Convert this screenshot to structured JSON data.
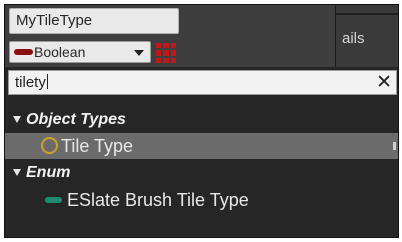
{
  "variable": {
    "name_value": "MyTileType",
    "type_label": "Boolean",
    "pin_color": "#8c0f0f",
    "grid_icon": "container-type-grid-icon"
  },
  "details_tab": {
    "label": "ails"
  },
  "search": {
    "value": "tilety",
    "clear_icon": "close-x-icon"
  },
  "results": {
    "categories": [
      {
        "label": "Object Types",
        "items": [
          {
            "label": "Tile Type",
            "icon": "ring-icon",
            "icon_color": "#c9a227",
            "selected": true
          }
        ]
      },
      {
        "label": "Enum",
        "items": [
          {
            "label": "ESlate Brush Tile Type",
            "icon": "enum-pin-icon",
            "icon_color": "#1f8a74",
            "selected": false
          }
        ]
      }
    ]
  }
}
